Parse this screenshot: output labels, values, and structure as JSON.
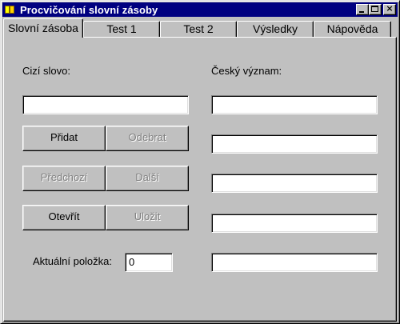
{
  "window": {
    "title": "Procvičování slovní zásoby",
    "controls": {
      "minimize": "_",
      "maximize": "□",
      "close": "×"
    }
  },
  "tabs": [
    {
      "label": "Slovní zásoba",
      "active": true
    },
    {
      "label": "Test 1",
      "active": false
    },
    {
      "label": "Test 2",
      "active": false
    },
    {
      "label": "Výsledky",
      "active": false
    },
    {
      "label": "Nápověda",
      "active": false
    }
  ],
  "panel": {
    "foreign_word_label": "Cizí slovo:",
    "czech_meaning_label": "Český význam:",
    "foreign_word_value": "",
    "czech_meanings": [
      "",
      "",
      "",
      "",
      ""
    ],
    "buttons": {
      "add": "Přidat",
      "remove": "Odebrat",
      "previous": "Předchozí",
      "next": "Další",
      "open": "Otevřít",
      "save": "Uložit"
    },
    "current_item_label": "Aktuální položka:",
    "current_item_value": "0"
  },
  "colors": {
    "titlebar": "#000080",
    "face": "#c0c0c0",
    "disabled_text": "#808080"
  }
}
